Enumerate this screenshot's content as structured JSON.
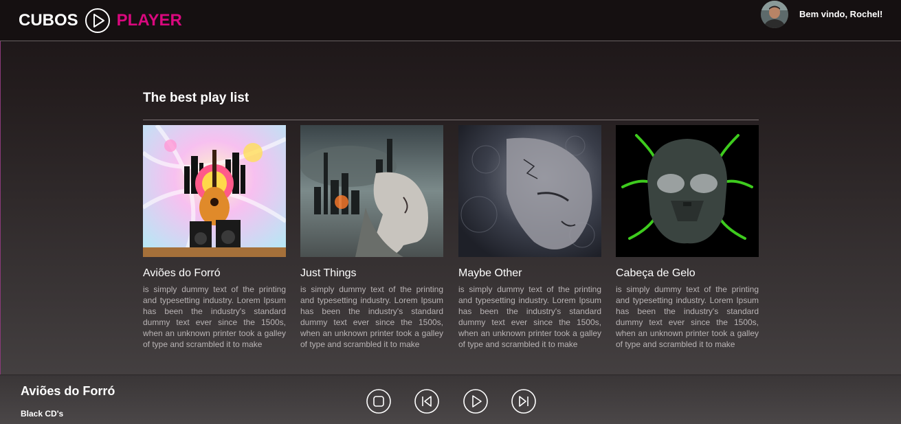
{
  "header": {
    "logo_left": "CUBOS",
    "logo_right": "PLAYER",
    "welcome": "Bem vindo, Rochel!"
  },
  "section": {
    "title": "The best play list"
  },
  "playlists": [
    {
      "title": "Aviões do Forró",
      "description": "is simply dummy text of the printing and typesetting industry. Lorem Ipsum has been the industry's standard dummy text ever since the 1500s, when an unknown printer took a galley of type and scrambled it to make"
    },
    {
      "title": "Just Things",
      "description": "is simply dummy text of the printing and typesetting industry. Lorem Ipsum has been the industry's standard dummy text ever since the 1500s, when an unknown printer took a galley of type and scrambled it to make"
    },
    {
      "title": "Maybe Other",
      "description": "is simply dummy text of the printing and typesetting industry. Lorem Ipsum has been the industry's standard dummy text ever since the 1500s, when an unknown printer took a galley of type and scrambled it to make"
    },
    {
      "title": "Cabeça de Gelo",
      "description": "is simply dummy text of the printing and typesetting industry. Lorem Ipsum has been the industry's standard dummy text ever since the 1500s, when an unknown printer took a galley of type and scrambled it to make"
    }
  ],
  "player": {
    "track_title": "Aviões do Forró",
    "artist": "Black CD's",
    "controls": [
      "stop-icon",
      "previous-icon",
      "play-icon",
      "next-icon"
    ]
  },
  "colors": {
    "accent": "#d9087e",
    "text": "#ffffff",
    "muted_text": "#b9b4b5"
  }
}
